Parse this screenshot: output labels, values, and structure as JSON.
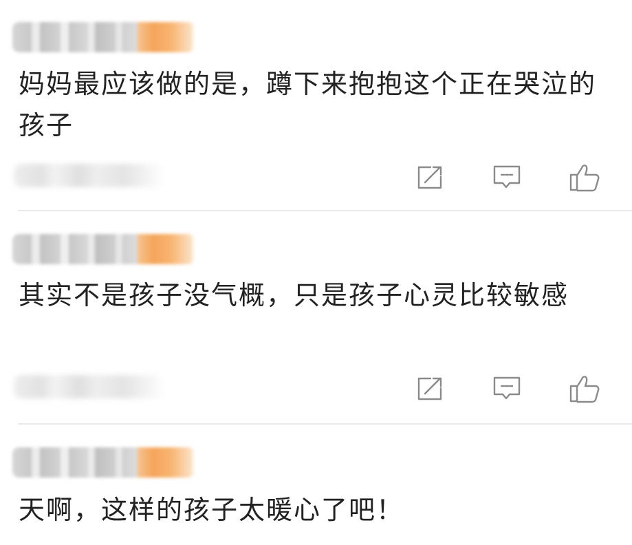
{
  "comments": [
    {
      "text": "妈妈最应该做的是，蹲下来抱抱这个正在哭泣的孩子",
      "actions": {
        "share_icon": "share-icon",
        "reply_icon": "comment-icon",
        "like_icon": "thumbs-up-icon"
      }
    },
    {
      "text": "其实不是孩子没气概，只是孩子心灵比较敏感",
      "actions": {
        "share_icon": "share-icon",
        "reply_icon": "comment-icon",
        "like_icon": "thumbs-up-icon"
      }
    },
    {
      "text": "天啊，这样的孩子太暖心了吧！"
    }
  ],
  "colors": {
    "text": "#222222",
    "icon": "#8a8a8a",
    "divider": "#e9e9e9",
    "accent": "#f5a55c"
  }
}
